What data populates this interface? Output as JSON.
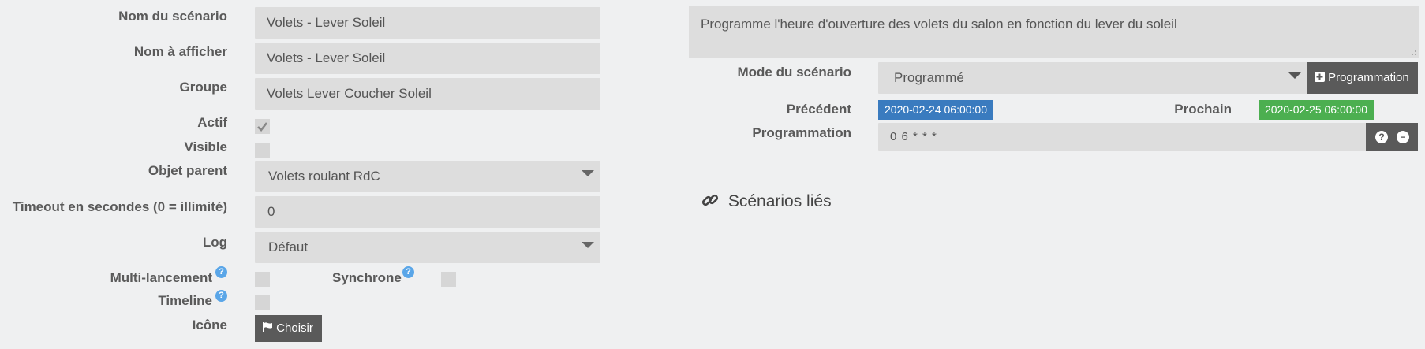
{
  "colors": {
    "accent_blue": "#3a7bbf",
    "accent_green": "#4caf50",
    "help_blue": "#5aa6e8",
    "button_dark": "#5a5a5a",
    "field_bg": "#dddddd"
  },
  "form": {
    "name": {
      "label": "Nom du scénario",
      "value": "Volets - Lever Soleil"
    },
    "display_name": {
      "label": "Nom à afficher",
      "value": "Volets - Lever Soleil"
    },
    "group": {
      "label": "Groupe",
      "value": "Volets Lever Coucher Soleil"
    },
    "active": {
      "label": "Actif",
      "checked": true
    },
    "visible": {
      "label": "Visible",
      "checked": false
    },
    "parent": {
      "label": "Objet parent",
      "value": "Volets roulant RdC"
    },
    "timeout": {
      "label": "Timeout en secondes (0 = illimité)",
      "value": "0"
    },
    "log": {
      "label": "Log",
      "value": "Défaut"
    },
    "multi_launch": {
      "label": "Multi-lancement",
      "help": "?",
      "checked": false
    },
    "sync": {
      "label": "Synchrone",
      "help": "?",
      "checked": false
    },
    "timeline": {
      "label": "Timeline",
      "help": "?",
      "checked": false
    },
    "icon": {
      "label": "Icône",
      "button_label": "Choisir",
      "icon": "flag-icon"
    }
  },
  "right": {
    "description": "Programme l'heure d'ouverture des volets du salon en fonction du lever du soleil",
    "mode": {
      "label": "Mode du scénario",
      "value": "Programmé",
      "button_label": "Programmation",
      "button_icon": "plus-square-icon"
    },
    "previous": {
      "label": "Précédent",
      "value": "2020-02-24 06:00:00"
    },
    "next": {
      "label": "Prochain",
      "value": "2020-02-25 06:00:00"
    },
    "schedule": {
      "label": "Programmation",
      "value": "0 6 * * *",
      "help_icon": "question-circle-icon",
      "remove_icon": "minus-circle-icon"
    },
    "linked": {
      "title": "Scénarios liés",
      "icon": "link-icon"
    }
  }
}
